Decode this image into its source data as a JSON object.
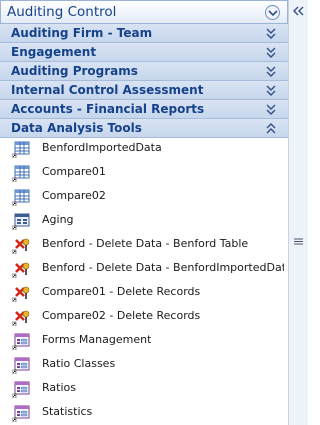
{
  "pane": {
    "title": "Auditing Control"
  },
  "groups": [
    {
      "label": "Auditing Firm - Team",
      "expanded": false
    },
    {
      "label": "Engagement",
      "expanded": false
    },
    {
      "label": "Auditing Programs",
      "expanded": false
    },
    {
      "label": "Internal Control Assessment",
      "expanded": false
    },
    {
      "label": "Accounts - Financial Reports",
      "expanded": false
    },
    {
      "label": "Data Analysis Tools",
      "expanded": true
    }
  ],
  "items": [
    {
      "label": "BenfordImportedData",
      "icon": "table-icon"
    },
    {
      "label": "Compare01",
      "icon": "table-icon"
    },
    {
      "label": "Compare02",
      "icon": "table-icon"
    },
    {
      "label": "Aging",
      "icon": "query-icon"
    },
    {
      "label": "Benford - Delete Data - Benford Table",
      "icon": "delete-query-icon"
    },
    {
      "label": "Benford - Delete Data - BenfordImportedData",
      "icon": "delete-query-icon"
    },
    {
      "label": "Compare01 - Delete Records",
      "icon": "delete-query-icon"
    },
    {
      "label": "Compare02 - Delete Records",
      "icon": "delete-query-icon"
    },
    {
      "label": "Forms Management",
      "icon": "form-icon"
    },
    {
      "label": "Ratio Classes",
      "icon": "form-icon"
    },
    {
      "label": "Ratios",
      "icon": "form-icon"
    },
    {
      "label": "Statistics",
      "icon": "form-icon"
    }
  ],
  "colors": {
    "header_text": "#15428b",
    "group_bg": "#c6d6ec",
    "accent": "#6f8fbf"
  }
}
